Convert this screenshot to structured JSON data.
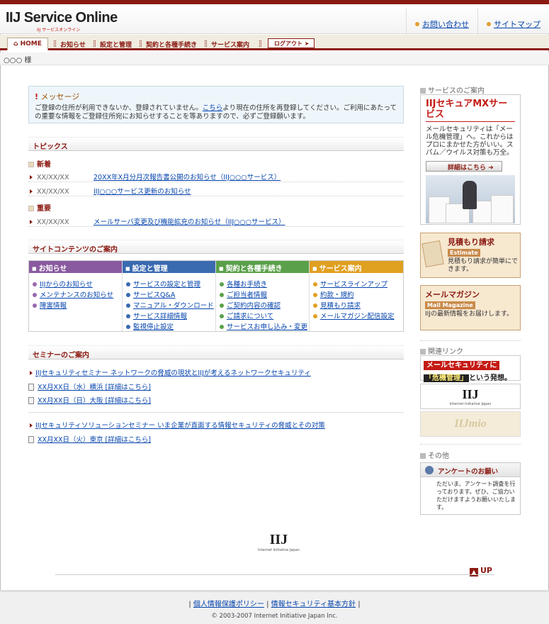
{
  "header": {
    "logo_text": "IIJ Service Online",
    "logo_sub": "IIJ サービスオンライン",
    "links": [
      "お問い合わせ",
      "サイトマップ"
    ]
  },
  "nav": {
    "home": "HOME",
    "items": [
      "お知らせ",
      "設定と管理",
      "契約と各種手続き",
      "サービス案内"
    ],
    "logout": "ログアウト"
  },
  "user": {
    "name": "○○○ 様"
  },
  "message": {
    "title": "メッセージ",
    "body_pre": "ご登録の住所が利用できないか、登録されていません。",
    "body_link": "こちら",
    "body_post": "より現在の住所を再登録してください。ご利用にあたっての重要な情報をご登録住所宛にお知らせすることを等ありますので、必ずご登録願います。"
  },
  "topics": {
    "title": "トピックス",
    "new_label": "新着",
    "important_label": "重要",
    "new_items": [
      {
        "date": "XX/XX/XX",
        "text": "20XX年X月分月次報告書公開のお知らせ（IIJ○○○サービス）"
      },
      {
        "date": "XX/XX/XX",
        "text": "IIJ○○○サービス更新のお知らせ"
      }
    ],
    "important_items": [
      {
        "date": "XX/XX/XX",
        "text": "メールサーバ変更及び機能拡充のお知らせ（IIJ○○○サービス）"
      }
    ]
  },
  "site_contents": {
    "title": "サイトコンテンツのご案内",
    "columns": [
      {
        "header": "お知らせ",
        "color": "#8a5aa0",
        "bullet": "#9a6ab0",
        "items": [
          "IIJからのお知らせ",
          "メンテナンスのお知らせ",
          "障害情報"
        ]
      },
      {
        "header": "設定と管理",
        "color": "#3a6ab0",
        "bullet": "#3a6ab0",
        "items": [
          "サービスの設定と管理",
          "サービスQ&A",
          "マニュアル・ダウンロード",
          "サービス詳細情報",
          "監視停止設定"
        ]
      },
      {
        "header": "契約と各種手続き",
        "color": "#5aa04a",
        "bullet": "#5aa04a",
        "items": [
          "各種お手続き",
          "ご担当者情報",
          "ご契約内容の確認",
          "ご請求について",
          "サービスお申し込み・変更"
        ]
      },
      {
        "header": "サービス案内",
        "color": "#e0a020",
        "bullet": "#e0a020",
        "items": [
          "サービスラインアップ",
          "約款・規約",
          "見積もり請求",
          "メールマガジン配信設定"
        ]
      }
    ]
  },
  "seminar": {
    "title": "セミナーのご案内",
    "groups": [
      {
        "title": "IIJセキュリティセミナー ネットワークの脅威の現状とIIJが考えるネットワークセキュリティ",
        "items": [
          "XX月XX日（水）横浜 [詳細はこちら]",
          "XX月XX日（日）大阪 [詳細はこちら]"
        ]
      },
      {
        "title": "IIJセキュリティソリューションセミナー いま企業が直面する情報セキュリティの脅威とその対策",
        "items": [
          "XX月XX日（火）東京 [詳細はこちら]"
        ]
      }
    ]
  },
  "sidebar": {
    "service_title": "サービスのご案内",
    "mx": {
      "heading": "IIJセキュアMXサービス",
      "desc": "メールセキュリティは「メール危機管理」へ。これからはプロにまかせた方がいい。スパム／ウイルス対策も万全。",
      "button": "詳細はこちら"
    },
    "estimate": {
      "title": "見積もり請求",
      "en": "Estimate",
      "desc": "見積もり請求が簡単にできます。"
    },
    "mailmag": {
      "title": "メールマガジン",
      "en": "Mail Magazine",
      "desc": "IIJの最新情報をお届けします。"
    },
    "related_title": "関連リンク",
    "banner1_a": "メールセキュリティに",
    "banner1_b": "「危機管理」",
    "banner1_c": "という発想。",
    "banner2_logo": "IIJ",
    "banner2_sub": "Internet Initiative Japan",
    "banner3_logo": "IIJmio",
    "other_title": "その他",
    "survey": {
      "title": "アンケートのお願い",
      "desc": "ただいま、アンケート調査を行っております。ぜひ、ご協力いただけますようお願いいたします。"
    }
  },
  "footer": {
    "logo": "IIJ",
    "logo_sub": "Internet Initiative Japan",
    "up": "UP",
    "links": [
      "個人情報保護ポリシー",
      "情報セキュリティ基本方針"
    ],
    "copyright": "© 2003-2007 Internet Initiative Japan Inc."
  }
}
